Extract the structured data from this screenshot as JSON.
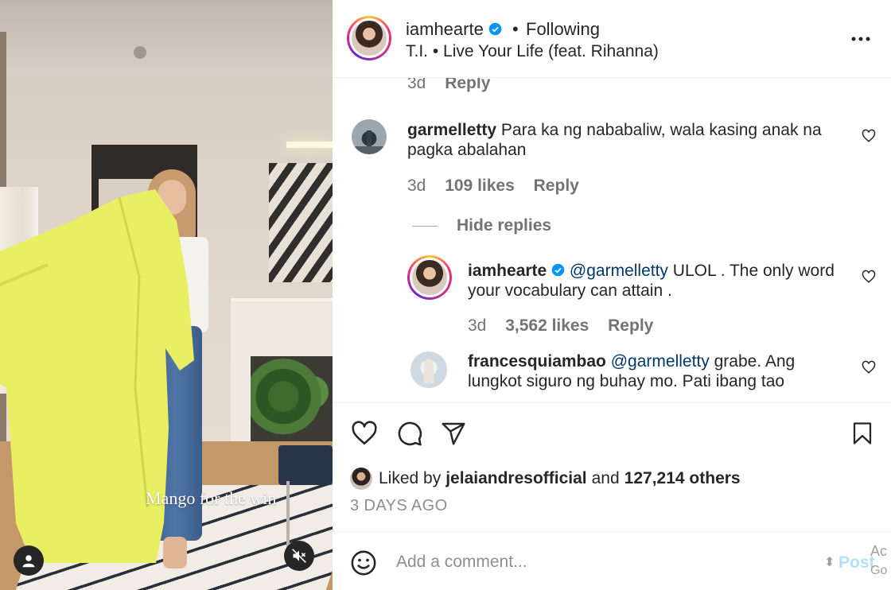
{
  "video": {
    "caption": "Mango for the win",
    "controls": {
      "user_icon": "user-icon",
      "mute_icon": "muted-speaker-icon"
    }
  },
  "header": {
    "username": "iamhearte",
    "separator": "•",
    "follow_status": "Following",
    "audio_track": "T.I. • Live Your Life (feat. Rihanna)",
    "more_icon": "more-options-icon"
  },
  "comments": {
    "partial_meta": {
      "age": "3d",
      "reply": "Reply"
    },
    "items": [
      {
        "username": "garmelletty",
        "text": "Para ka ng nababaliw, wala kasing anak na pagka abalahan",
        "age": "3d",
        "likes": "109 likes",
        "reply": "Reply"
      }
    ],
    "hide_replies": "Hide replies",
    "replies": [
      {
        "username": "iamhearte",
        "mention": "@garmelletty",
        "text": "ULOL . The only word your vocabulary can attain .",
        "age": "3d",
        "likes": "3,562 likes",
        "reply": "Reply"
      },
      {
        "username": "francesquiambao",
        "mention": "@garmelletty",
        "text": "grabe. Ang lungkot siguro ng buhay mo. Pati ibang tao"
      }
    ]
  },
  "actions": {
    "icons": [
      "heart-icon",
      "comment-icon",
      "share-icon",
      "bookmark-icon"
    ],
    "liked_by_prefix": "Liked by",
    "liked_by_user": "jelaiandresofficial",
    "liked_by_and": "and",
    "liked_by_count": "127,214 others",
    "time_ago": "3 DAYS AGO"
  },
  "composer": {
    "placeholder": "Add a comment...",
    "post_label": "Post",
    "overlay_ac": "Ac",
    "overlay_go": "Go"
  },
  "colors": {
    "accent_link": "#00376b",
    "post_disabled": "#b2dffc",
    "verified_badge": "#0095f6",
    "muted_text": "#737373"
  }
}
